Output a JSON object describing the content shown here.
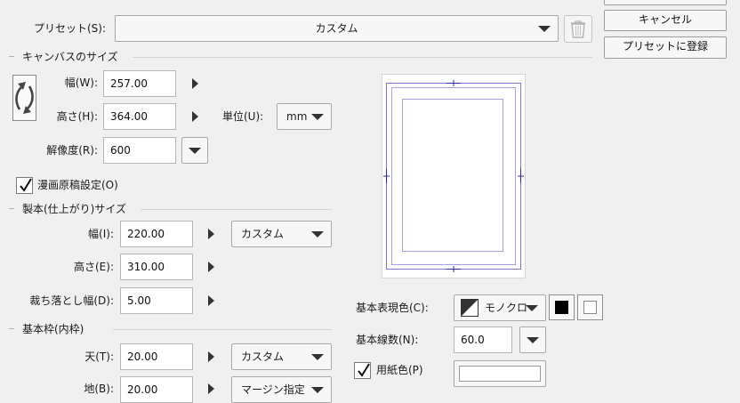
{
  "preset": {
    "label": "プリセット(S):",
    "value": "カスタム"
  },
  "buttons": {
    "cancel": "キャンセル",
    "register_preset": "プリセットに登録"
  },
  "canvas_size": {
    "header": "キャンバスのサイズ",
    "width_label": "幅(W):",
    "width_value": "257.00",
    "height_label": "高さ(H):",
    "height_value": "364.00",
    "unit_label": "単位(U):",
    "unit_value": "mm",
    "resolution_label": "解像度(R):",
    "resolution_value": "600"
  },
  "manga_settings": {
    "label": "漫画原稿設定(O)",
    "checked": true
  },
  "trim_size": {
    "header": "製本(仕上がり)サイズ",
    "width_label": "幅(I):",
    "width_value": "220.00",
    "preset_value": "カスタム",
    "height_label": "高さ(E):",
    "height_value": "310.00",
    "bleed_label": "裁ち落とし幅(D):",
    "bleed_value": "5.00"
  },
  "base_frame": {
    "header": "基本枠(内枠)",
    "top_label": "天(T):",
    "top_value": "20.00",
    "top_preset": "カスタム",
    "bottom_label": "地(B):",
    "bottom_value": "20.00",
    "bottom_preset": "マージン指定"
  },
  "display": {
    "color_label": "基本表現色(C):",
    "color_value": "モノクロ",
    "lines_label": "基本線数(N):",
    "lines_value": "60.0",
    "paper_color_label": "用紙色(P)",
    "paper_color_checked": true,
    "paper_color": "#ffffff"
  },
  "colors": {
    "accent_line": "#6b63c7",
    "cross_mark": "#2a2aa8"
  }
}
